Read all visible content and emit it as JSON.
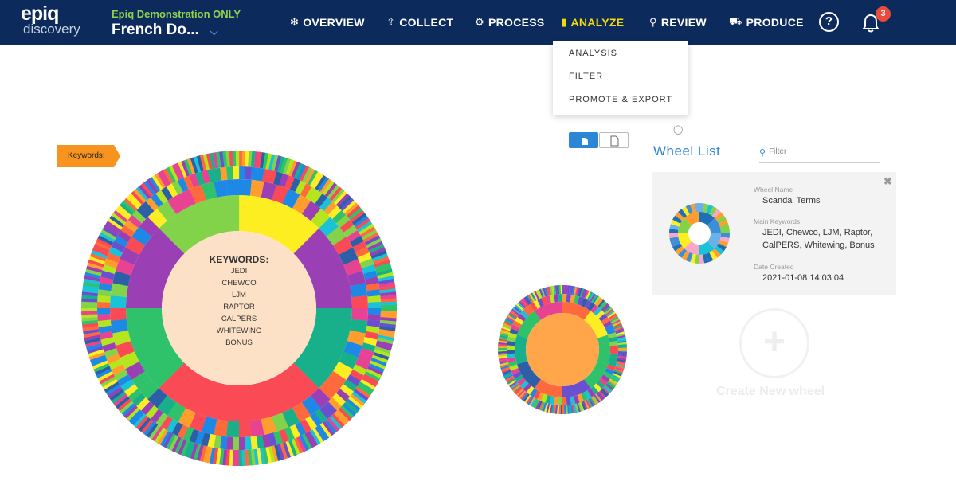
{
  "header": {
    "logo_main": "epiq",
    "logo_sub": "discovery",
    "case_label": "Epiq Demonstration ONLY",
    "case_name": "French Do...",
    "nav": [
      {
        "label": "OVERVIEW",
        "icon": "overview-icon"
      },
      {
        "label": "COLLECT",
        "icon": "collect-icon"
      },
      {
        "label": "PROCESS",
        "icon": "gear-icon"
      },
      {
        "label": "ANALYZE",
        "icon": "bar-chart-icon",
        "active": true
      },
      {
        "label": "REVIEW",
        "icon": "search-icon"
      },
      {
        "label": "PRODUCE",
        "icon": "truck-icon"
      }
    ],
    "help": "?",
    "notification_count": "3",
    "colors": {
      "bar": "#0c2a5b",
      "active": "#f5d90a",
      "case_label": "#8fd14f",
      "badge": "#e74c3c"
    }
  },
  "dropdown": {
    "items": [
      "ANALYSIS",
      "FILTER",
      "PROMOTE & EXPORT"
    ]
  },
  "keywords_flag": {
    "label": "Keywords:",
    "color": "#f7931e"
  },
  "main_wheel": {
    "title": "KEYWORDS:",
    "keywords": [
      "JEDI",
      "CHEWCO",
      "LJM",
      "RAPTOR",
      "CALPERS",
      "WHITEWING",
      "BONUS"
    ],
    "center_color": "#fde1c7",
    "inner_ring_colors": [
      "#fcee21",
      "#9b3fb5",
      "#17b08a",
      "#f94a55",
      "#f94a55",
      "#2fc26a",
      "#9b3fb5",
      "#82d34a"
    ]
  },
  "wheel_list": {
    "title": "Wheel List",
    "filter_placeholder": "Filter",
    "card": {
      "name_label": "Wheel Name",
      "name": "Scandal Terms",
      "keywords_label": "Main Keywords",
      "keywords": "JEDI, Chewco, LJM, Raptor, CalPERS, Whitewing, Bonus",
      "date_label": "Date Created",
      "date": "2021-01-08 14:03:04"
    },
    "create_label": "Create New wheel"
  },
  "small_wheel": {
    "center_color": "#ffa54a"
  },
  "palette": [
    "#fcee21",
    "#9b3fb5",
    "#17b08a",
    "#f94a55",
    "#2fc26a",
    "#82d34a",
    "#1e88e5",
    "#ff9e2c",
    "#19c2d6",
    "#e84393",
    "#2c5fa8",
    "#6a4fd0",
    "#b5e61d",
    "#ff6a3d"
  ]
}
